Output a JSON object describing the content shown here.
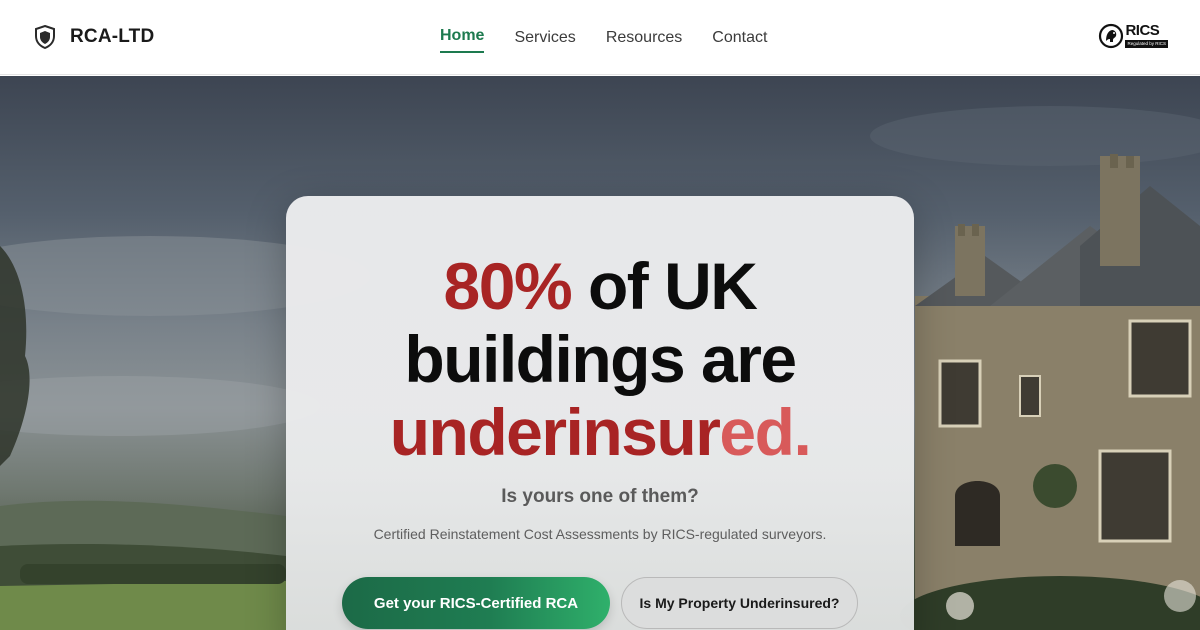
{
  "brand": {
    "name": "RCA-LTD",
    "icon": "shield-icon"
  },
  "nav": {
    "items": [
      {
        "label": "Home",
        "active": true
      },
      {
        "label": "Services",
        "active": false
      },
      {
        "label": "Resources",
        "active": false
      },
      {
        "label": "Contact",
        "active": false
      }
    ]
  },
  "badge": {
    "word": "RICS",
    "tagline": "Regulated by RICS",
    "icon": "rics-lion-emblem-icon"
  },
  "hero": {
    "headline": {
      "stat": "80%",
      "line1_rest": " of UK",
      "line2": "buildings are",
      "line3_main": "underinsur",
      "line3_tail": "ed."
    },
    "subheading": "Is yours one of them?",
    "description": "Certified Reinstatement Cost Assessments by RICS-regulated surveyors.",
    "primary_cta": "Get your RICS-Certified RCA",
    "secondary_cta": "Is My Property Underinsured?"
  },
  "colors": {
    "accent_green": "#1d7a4f",
    "headline_red": "#a82424",
    "headline_red_light": "#d85a5a"
  }
}
